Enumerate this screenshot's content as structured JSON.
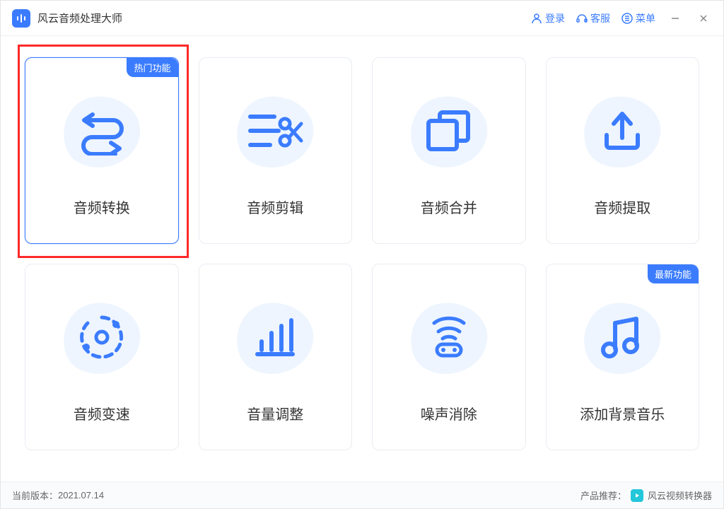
{
  "app": {
    "title": "风云音频处理大师"
  },
  "titlebar": {
    "login": "登录",
    "support": "客服",
    "menu": "菜单"
  },
  "grid": {
    "cards": [
      {
        "label": "音频转换",
        "badge": "热门功能"
      },
      {
        "label": "音频剪辑"
      },
      {
        "label": "音频合并"
      },
      {
        "label": "音频提取"
      },
      {
        "label": "音频变速"
      },
      {
        "label": "音量调整"
      },
      {
        "label": "噪声消除"
      },
      {
        "label": "添加背景音乐",
        "badge": "最新功能"
      }
    ]
  },
  "statusbar": {
    "version_label": "当前版本：",
    "version": "2021.07.14",
    "recommend_label": "产品推荐：",
    "recommend_product": "风云视频转换器"
  }
}
